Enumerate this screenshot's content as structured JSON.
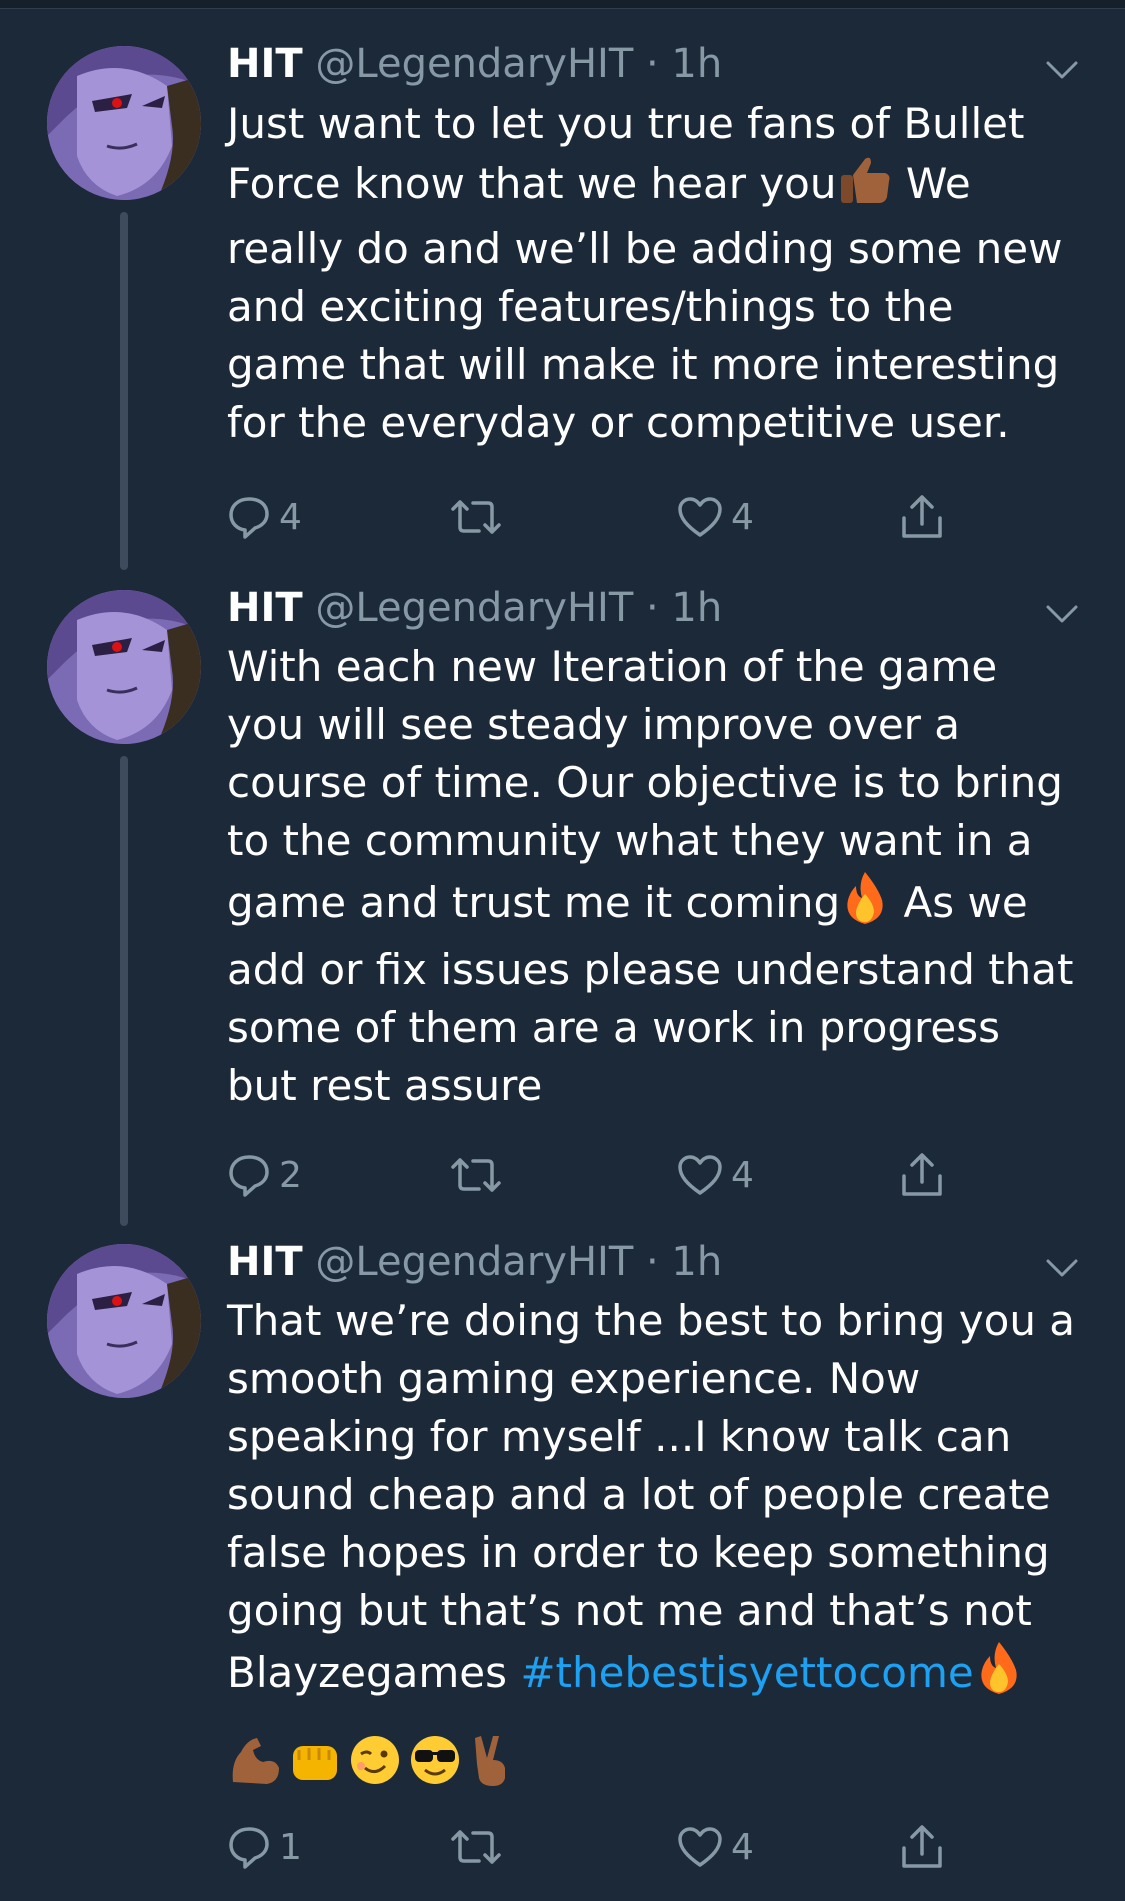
{
  "tweets": [
    {
      "name": "HIT",
      "handle": "@LegendaryHIT",
      "sep": "·",
      "time": "1h",
      "text_parts": [
        "Just want to let you true fans of Bullet\nForce know that we hear you",
        " We\nreally do and we’ll be adding some new\nand exciting features/things to the\ngame that will make it more interesting\nfor the everyday or competitive user."
      ],
      "reply_count": "4",
      "retweet_count": "",
      "like_count": "4"
    },
    {
      "name": "HIT",
      "handle": "@LegendaryHIT",
      "sep": "·",
      "time": "1h",
      "text_parts": [
        "With each new Iteration of the game\nyou will see steady improve over a\ncourse of time. Our objective is to bring\nto the community what they want in a\ngame and trust me it coming",
        " As we\nadd or fix issues please understand that\nsome of them are a work in progress\nbut rest assure"
      ],
      "reply_count": "2",
      "retweet_count": "",
      "like_count": "4"
    },
    {
      "name": "HIT",
      "handle": "@LegendaryHIT",
      "sep": "·",
      "time": "1h",
      "text_parts": [
        "That we’re doing the best to bring you a\nsmooth gaming experience. Now\nspeaking for myself ...I know talk can\nsound cheap and a lot of people create\nfalse hopes in order to keep something\ngoing but that’s not me and that’s not\nBlayzegames "
      ],
      "hashtag": "#thebestisyettocome",
      "reply_count": "1",
      "retweet_count": "",
      "like_count": "4"
    }
  ],
  "icons": {
    "reply": "reply-icon",
    "retweet": "retweet-icon",
    "like": "heart-icon",
    "share": "share-icon",
    "more": "chevron-down-icon"
  },
  "colors": {
    "background": "#1c2938",
    "secondary_text": "#8899a6",
    "hashtag": "#1da1f2",
    "thread_line": "#3d4b5c"
  }
}
